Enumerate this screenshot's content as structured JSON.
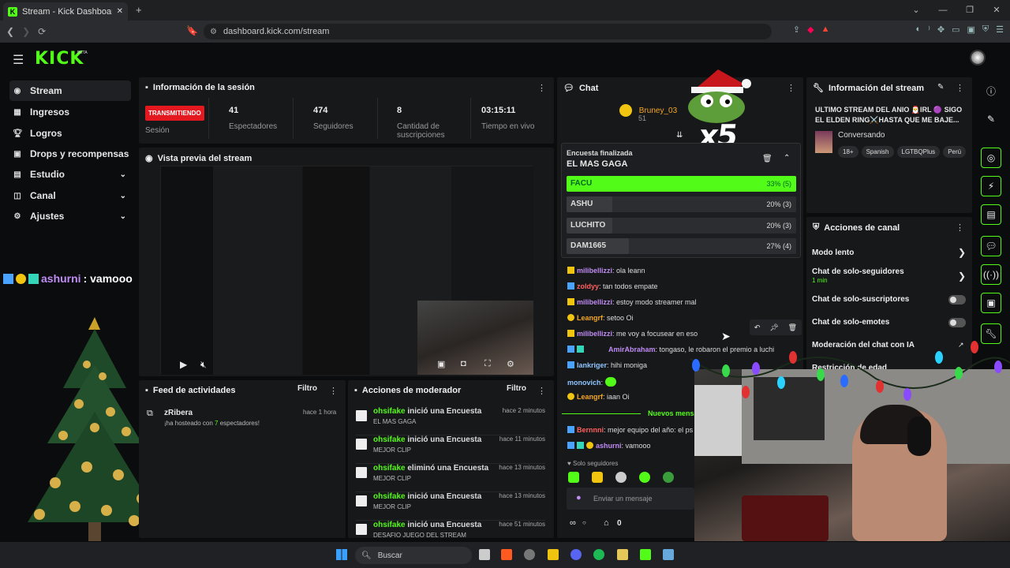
{
  "browser": {
    "tab_title": "Stream - Kick Dashboard",
    "url": "dashboard.kick.com/stream"
  },
  "app": {
    "logo": "KICK",
    "beta": "BETA"
  },
  "sidebar": {
    "items": [
      {
        "label": "Stream",
        "icon": "broadcast-icon",
        "active": true
      },
      {
        "label": "Ingresos",
        "icon": "income-icon"
      },
      {
        "label": "Logros",
        "icon": "trophy-icon"
      },
      {
        "label": "Drops y recompensas",
        "icon": "gift-icon"
      },
      {
        "label": "Estudio",
        "icon": "studio-icon",
        "chevron": true
      },
      {
        "label": "Canal",
        "icon": "channel-icon",
        "chevron": true
      },
      {
        "label": "Ajustes",
        "icon": "gear-icon",
        "chevron": true
      }
    ]
  },
  "overlay_chat": {
    "user": "ashurni",
    "text": ": vamooo"
  },
  "session": {
    "title": "Información de la sesión",
    "status": "TRANSMITIENDO",
    "status_label": "Sesión",
    "stats": [
      {
        "value": "41",
        "label": "Espectadores"
      },
      {
        "value": "474",
        "label": "Seguidores"
      },
      {
        "value": "8",
        "label": "Cantidad de suscripciones"
      },
      {
        "value": "03:15:11",
        "label": "Tiempo en vivo"
      }
    ]
  },
  "preview": {
    "title": "Vista previa del stream"
  },
  "activity": {
    "title": "Feed de actividades",
    "filter": "Filtro",
    "items": [
      {
        "user": "zRibera",
        "time": "hace 1 hora",
        "text_a": "¡ha hosteado con ",
        "count": "7",
        "text_b": " espectadores!"
      }
    ]
  },
  "mod": {
    "title": "Acciones de moderador",
    "filter": "Filtro",
    "items": [
      {
        "user": "ohsifake",
        "action": "inició una Encuesta",
        "detail": "EL MAS GAGA",
        "time": "hace 2 minutos"
      },
      {
        "user": "ohsifake",
        "action": "inició una Encuesta",
        "detail": "MEJOR CLIP",
        "time": "hace 11 minutos"
      },
      {
        "user": "ohsifake",
        "action": "eliminó una Encuesta",
        "detail": "MEJOR CLIP",
        "time": "hace 13 minutos"
      },
      {
        "user": "ohsifake",
        "action": "inició una Encuesta",
        "detail": "MEJOR CLIP",
        "time": "hace 13 minutos"
      },
      {
        "user": "ohsifake",
        "action": "inició una Encuesta",
        "detail": "DESAFIO JUEGO DEL STREAM",
        "time": "hace 51 minutos"
      }
    ]
  },
  "chat": {
    "title": "Chat",
    "pinned_user": "Bruney_03",
    "pinned_count": "51",
    "multiplier": "x5",
    "poll": {
      "status": "Encuesta finalizada",
      "question": "EL MAS GAGA",
      "options": [
        {
          "name": "FACU",
          "pct": "33% (5)",
          "fraction": 0.33,
          "winner": true
        },
        {
          "name": "ASHU",
          "pct": "20% (3)",
          "fraction": 0.2
        },
        {
          "name": "LUCHITO",
          "pct": "20% (3)",
          "fraction": 0.2
        },
        {
          "name": "DAM1665",
          "pct": "27% (4)",
          "fraction": 0.27
        }
      ]
    },
    "messages": [
      {
        "user": "milibellizzi",
        "text": ": ola leann",
        "c": "o"
      },
      {
        "user": "zoldyy",
        "text": ": tan todos empate",
        "c": "r"
      },
      {
        "user": "milibellizzi",
        "text": ": estoy modo streamer mal",
        "c": "o"
      },
      {
        "user": "Leangrf",
        "text": ": setoo Oi",
        "c": "o"
      },
      {
        "user": "milibellizzi",
        "text": ": me voy a focusear en eso",
        "c": "o"
      },
      {
        "user": "AmirAbraham",
        "text": ": tongaso, le robaron el premio a luchi",
        "c": "g"
      },
      {
        "user": "lankriger",
        "text": ": hihi moniga",
        "c": "b"
      },
      {
        "user": "monovich",
        "text": ":",
        "c": "b"
      },
      {
        "user": "Leangrf",
        "text": ": iaan Oi",
        "c": "o"
      }
    ],
    "new_label": "Nuevos mensajes",
    "recent": [
      {
        "user": "Bernnni",
        "text": ": mejor equipo del año: el ps",
        "c": "r"
      },
      {
        "user": "ashurni",
        "text": ": vamooo",
        "c": "p"
      }
    ],
    "followers_only": "Solo seguidores",
    "input_placeholder": "Enviar un mensaje",
    "points": "0"
  },
  "stream_info": {
    "title": "Información del stream",
    "stream_title": "ULTIMO STREAM DEL ANIO 🎅IRL 🟣 SIGO EL ELDEN RING⚔️HASTA QUE ME BAJE...",
    "category": "Conversando",
    "tags": [
      "18+",
      "Spanish",
      "LGTBQPlus",
      "Perú"
    ]
  },
  "channel_actions": {
    "title": "Acciones de canal",
    "items": [
      {
        "label": "Modo lento"
      },
      {
        "label": "Chat de solo-seguidores",
        "sub": "1 min"
      },
      {
        "label": "Chat de solo-suscriptores"
      },
      {
        "label": "Chat de solo-emotes"
      },
      {
        "label": "Moderación del chat con IA"
      },
      {
        "label": "Restricción de edad"
      }
    ]
  },
  "taskbar": {
    "search": "Buscar"
  }
}
